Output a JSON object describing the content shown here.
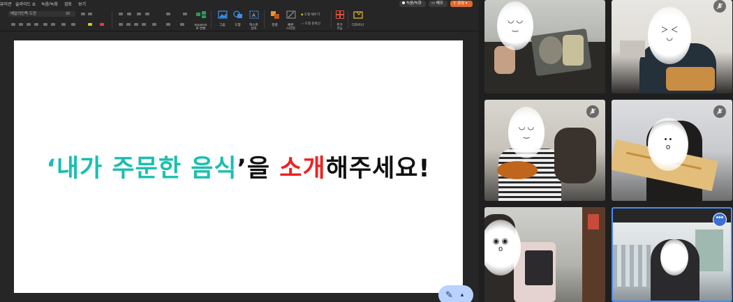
{
  "menubar": {
    "items": [
      "뷰이션",
      "슬라이드 쇼",
      "녹음/녹화",
      "검토",
      "보기"
    ],
    "record_label": "녹음/녹화",
    "comment_label": "메모",
    "share_label": "공유"
  },
  "ribbon": {
    "font_name": "배달의민족 도현",
    "font_size": "32",
    "smartart_label": "SmartArt\n로 변환",
    "picture_label": "그림",
    "shapes_label": "도형",
    "textbox_label": "텍스트\n상자",
    "arrange_label": "정렬",
    "quickstyles_label": "빠른\n스타일",
    "shape_fill_label": "도형 채우기",
    "shape_outline_label": "도형 윤곽선",
    "addins_label": "추가\n기능",
    "designer_label": "디자이너"
  },
  "slide": {
    "title_open_quote": "‘",
    "title_part1": "내가 주문한 음식",
    "title_close_quote": "’을 ",
    "title_part2": "소개",
    "title_part3": "해주세요!"
  },
  "colors": {
    "accent_teal": "#19bfae",
    "accent_red": "#ee2222",
    "active_speaker_border": "#4a8cf0",
    "share_orange": "#e1682c"
  },
  "participants": [
    {
      "face_glyph": "◡ ◡\n‿",
      "muted": false
    },
    {
      "face_glyph": "＞ ＜\n◡",
      "muted": true
    },
    {
      "face_glyph": "◡ ◡\n‿",
      "muted": true
    },
    {
      "face_glyph": "• •\no",
      "muted": true
    },
    {
      "face_glyph": "◉ ◉\no",
      "muted": false
    },
    {
      "face_glyph": "",
      "muted": false,
      "active": true,
      "more_label": "•••"
    }
  ]
}
